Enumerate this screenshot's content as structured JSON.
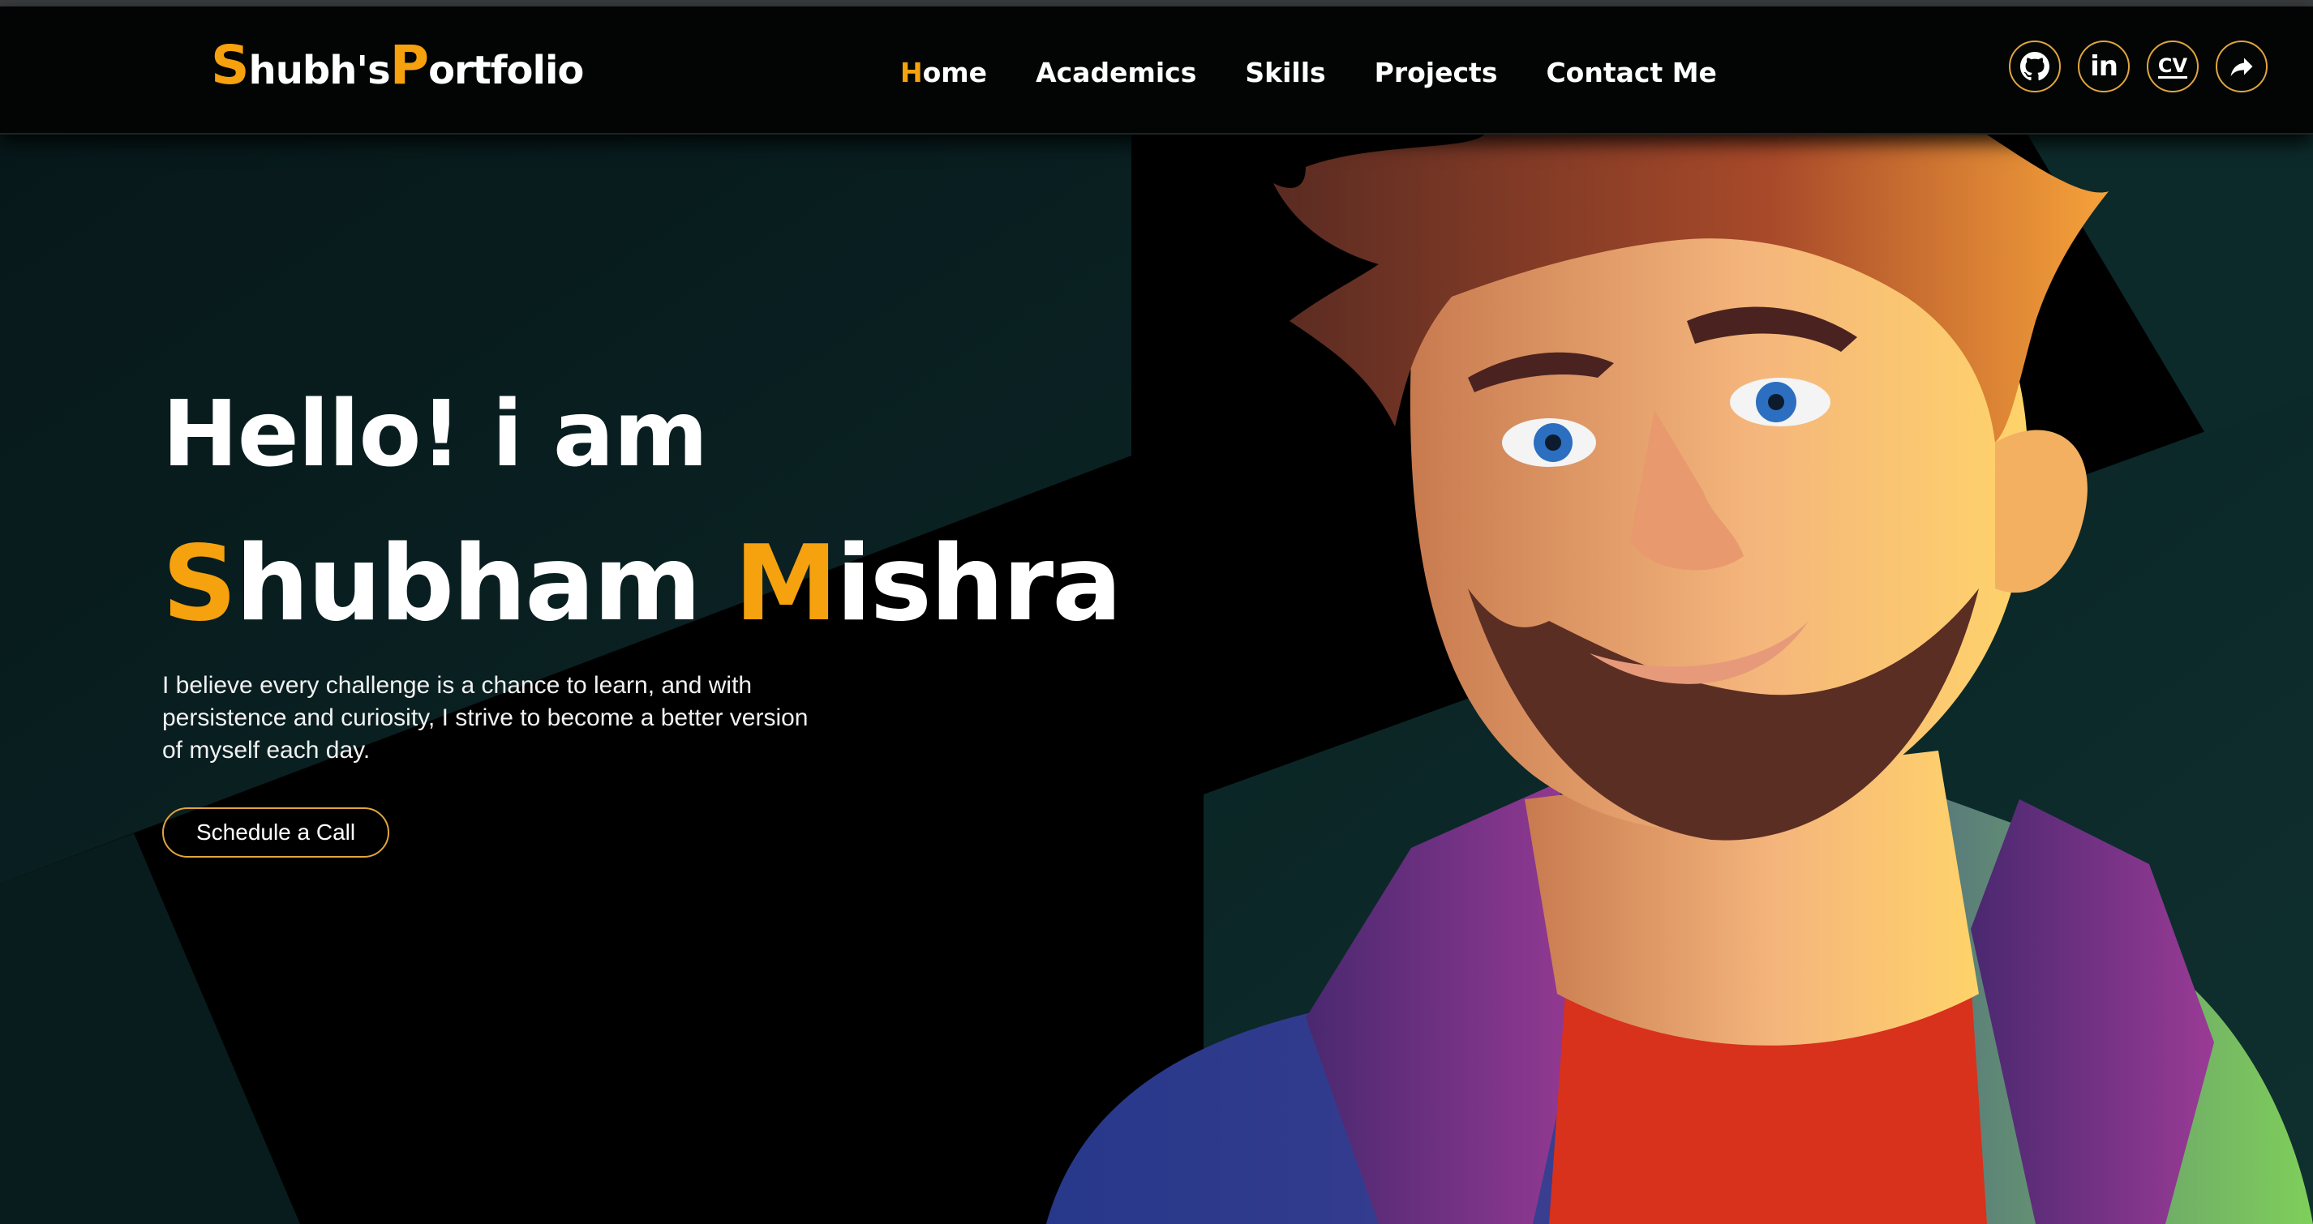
{
  "logo": {
    "part1_initial": "S",
    "part1_rest": "hubh's",
    "part2_initial": "P",
    "part2_rest": "ortfolio"
  },
  "nav": {
    "home_initial": "H",
    "home_rest": "ome",
    "academics": "Academics",
    "skills": "Skills",
    "projects": "Projects",
    "contact": "Contact Me"
  },
  "social": {
    "github_icon": "github-icon",
    "linkedin_label": "in",
    "cv_label": "CV",
    "share_icon": "share-icon"
  },
  "hero": {
    "greeting": "Hello! i am",
    "first_initial": "S",
    "first_rest": "hubham",
    "last_initial": "M",
    "last_rest": "ishra",
    "bio": "I believe every challenge is a chance to learn, and with persistence and curiosity, I strive to become a better version of myself each day.",
    "cta_label": "Schedule a Call"
  },
  "colors": {
    "accent": "#f6a10e",
    "button_border": "#e0a53e",
    "background": "#000000",
    "panel": "#0a1f1f"
  }
}
